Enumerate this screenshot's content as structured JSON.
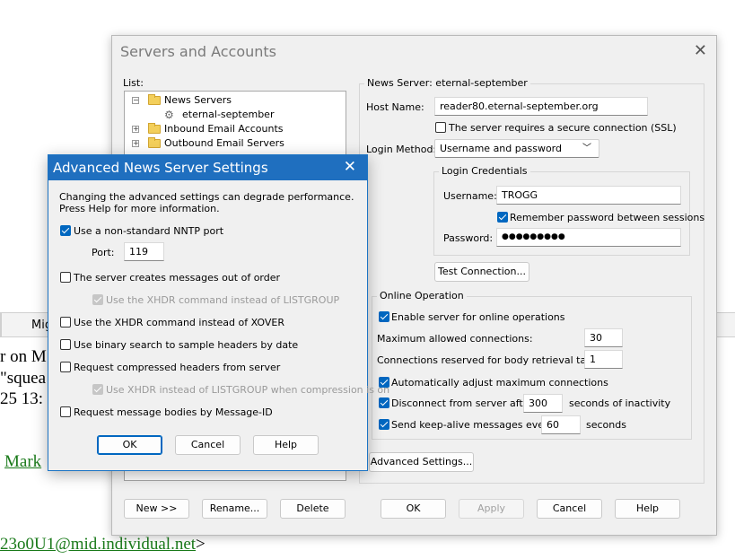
{
  "background": {
    "column_header": "Mig",
    "line1": "r on M",
    "line2": "\"squea",
    "line3": "25 13:",
    "link_name": "Mark",
    "link_msgid": "23o0U1@mid.individual.net",
    "msgid_suffix": ">"
  },
  "servers_dialog": {
    "title": "Servers and Accounts",
    "close_glyph": "✕",
    "list_label": "List:",
    "tree": [
      {
        "label": "News Servers",
        "expander": "−"
      },
      {
        "label": "eternal-september"
      },
      {
        "label": "Inbound Email Accounts",
        "expander": "+"
      },
      {
        "label": "Outbound Email Servers",
        "expander": "+"
      }
    ],
    "news_server_group": "News Server: eternal-september",
    "host_name_label": "Host Name:",
    "host_name_value": "reader80.eternal-september.org",
    "ssl_label": "The server requires a secure connection (SSL)",
    "login_method_label": "Login Method:",
    "login_method_value": "Username and password",
    "login_credentials_group": "Login Credentials",
    "username_label": "Username:",
    "username_value": "TROGG",
    "remember_label": "Remember password between sessions",
    "password_label": "Password:",
    "password_value": "●●●●●●●●●",
    "test_connection_label": "Test Connection...",
    "online_group": "Online Operation",
    "enable_online_label": "Enable server for online operations",
    "max_conn_label": "Maximum allowed connections:",
    "max_conn_value": "30",
    "body_conn_label": "Connections reserved for body retrieval tasks:",
    "body_conn_value": "1",
    "auto_adjust_label": "Automatically adjust maximum connections",
    "disconnect_label": "Disconnect from server after",
    "disconnect_value": "300",
    "disconnect_suffix": "seconds of inactivity",
    "keepalive_label": "Send keep-alive messages every",
    "keepalive_value": "60",
    "keepalive_suffix": "seconds",
    "advanced_settings_label": "Advanced Settings...",
    "new_label": "New >>",
    "rename_label": "Rename...",
    "delete_label": "Delete",
    "ok_label": "OK",
    "apply_label": "Apply",
    "cancel_label": "Cancel",
    "help_label": "Help"
  },
  "advanced_dialog": {
    "title": "Advanced News Server Settings",
    "close_glyph": "✕",
    "warning_line1": "Changing the advanced settings can degrade performance.",
    "warning_line2": "Press Help for more information.",
    "nonstandard_port_label": "Use a non-standard NNTP port",
    "port_label": "Port:",
    "port_value": "119",
    "out_of_order_label": "The server creates messages out of order",
    "xhdr_listgroup_label": "Use the XHDR command instead of LISTGROUP",
    "xhdr_xover_label": "Use the XHDR command instead of XOVER",
    "binary_search_label": "Use binary search to sample headers by date",
    "compressed_label": "Request compressed headers from server",
    "xhdr_compression_label": "Use XHDR instead of LISTGROUP when compression is on",
    "msgid_label": "Request message bodies by Message-ID",
    "ok_label": "OK",
    "cancel_label": "Cancel",
    "help_label": "Help"
  },
  "colors": {
    "accent": "#0067c0",
    "title_bar": "#1f6fbf",
    "link": "#1a7a1a"
  }
}
